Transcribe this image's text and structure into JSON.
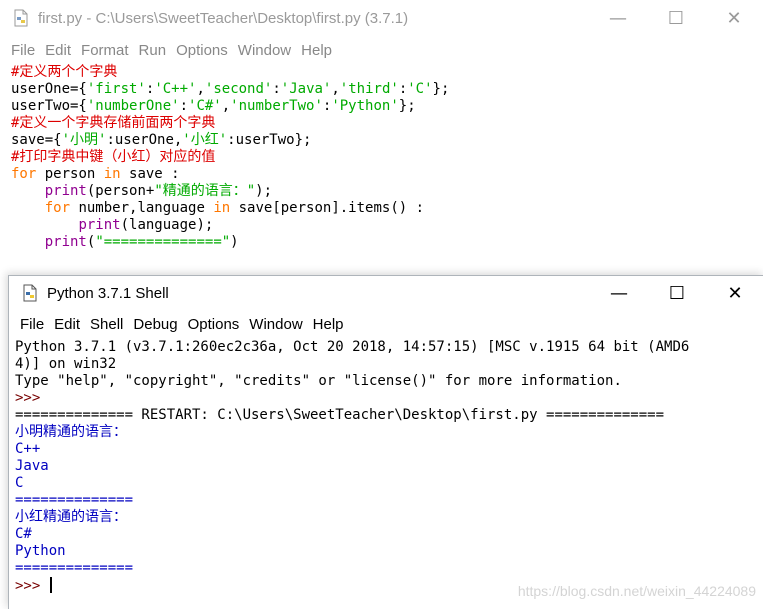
{
  "editor": {
    "title": "first.py - C:\\Users\\SweetTeacher\\Desktop\\first.py (3.7.1)",
    "menu": [
      "File",
      "Edit",
      "Format",
      "Run",
      "Options",
      "Window",
      "Help"
    ],
    "controls": {
      "minimize": "—",
      "maximize": "☐",
      "close": "✕"
    },
    "code": [
      [
        {
          "t": "#定义两个个字典",
          "c": "cmt"
        }
      ],
      [
        {
          "t": "userOne={",
          "c": ""
        },
        {
          "t": "'first'",
          "c": "str"
        },
        {
          "t": ":",
          "c": ""
        },
        {
          "t": "'C++'",
          "c": "str"
        },
        {
          "t": ",",
          "c": ""
        },
        {
          "t": "'second'",
          "c": "str"
        },
        {
          "t": ":",
          "c": ""
        },
        {
          "t": "'Java'",
          "c": "str"
        },
        {
          "t": ",",
          "c": ""
        },
        {
          "t": "'third'",
          "c": "str"
        },
        {
          "t": ":",
          "c": ""
        },
        {
          "t": "'C'",
          "c": "str"
        },
        {
          "t": "};",
          "c": ""
        }
      ],
      [
        {
          "t": "userTwo={",
          "c": ""
        },
        {
          "t": "'numberOne'",
          "c": "str"
        },
        {
          "t": ":",
          "c": ""
        },
        {
          "t": "'C#'",
          "c": "str"
        },
        {
          "t": ",",
          "c": ""
        },
        {
          "t": "'numberTwo'",
          "c": "str"
        },
        {
          "t": ":",
          "c": ""
        },
        {
          "t": "'Python'",
          "c": "str"
        },
        {
          "t": "};",
          "c": ""
        }
      ],
      [
        {
          "t": "#定义一个字典存储前面两个字典",
          "c": "cmt"
        }
      ],
      [
        {
          "t": "save={",
          "c": ""
        },
        {
          "t": "'小明'",
          "c": "str"
        },
        {
          "t": ":userOne,",
          "c": ""
        },
        {
          "t": "'小红'",
          "c": "str"
        },
        {
          "t": ":userTwo};",
          "c": ""
        }
      ],
      [
        {
          "t": "#打印字典中键（小红）对应的值",
          "c": "cmt"
        }
      ],
      [
        {
          "t": "for",
          "c": "kw"
        },
        {
          "t": " person ",
          "c": ""
        },
        {
          "t": "in",
          "c": "kw"
        },
        {
          "t": " save :",
          "c": ""
        }
      ],
      [
        {
          "t": "    ",
          "c": ""
        },
        {
          "t": "print",
          "c": "bi"
        },
        {
          "t": "(person+",
          "c": ""
        },
        {
          "t": "\"精通的语言：\"",
          "c": "str"
        },
        {
          "t": ");",
          "c": ""
        }
      ],
      [
        {
          "t": "    ",
          "c": ""
        },
        {
          "t": "for",
          "c": "kw"
        },
        {
          "t": " number,language ",
          "c": ""
        },
        {
          "t": "in",
          "c": "kw"
        },
        {
          "t": " save[person].items() :",
          "c": ""
        }
      ],
      [
        {
          "t": "        ",
          "c": ""
        },
        {
          "t": "print",
          "c": "bi"
        },
        {
          "t": "(language);",
          "c": ""
        }
      ],
      [
        {
          "t": "    ",
          "c": ""
        },
        {
          "t": "print",
          "c": "bi"
        },
        {
          "t": "(",
          "c": ""
        },
        {
          "t": "\"==============\"",
          "c": "str"
        },
        {
          "t": ")",
          "c": ""
        }
      ]
    ]
  },
  "shell": {
    "title": "Python 3.7.1 Shell",
    "menu": [
      "File",
      "Edit",
      "Shell",
      "Debug",
      "Options",
      "Window",
      "Help"
    ],
    "controls": {
      "minimize": "—",
      "maximize": "☐",
      "close": "✕"
    },
    "lines": [
      [
        {
          "t": "Python 3.7.1 (v3.7.1:260ec2c36a, Oct 20 2018, 14:57:15) [MSC v.1915 64 bit (AMD6",
          "c": "sys"
        }
      ],
      [
        {
          "t": "4)] on win32",
          "c": "sys"
        }
      ],
      [
        {
          "t": "Type \"help\", \"copyright\", \"credits\" or \"license()\" for more information.",
          "c": "sys"
        }
      ],
      [
        {
          "t": ">>>",
          "c": "prompt"
        }
      ],
      [
        {
          "t": "============== RESTART: C:\\Users\\SweetTeacher\\Desktop\\first.py ==============",
          "c": "sys"
        }
      ],
      [
        {
          "t": "小明精通的语言：",
          "c": "out"
        }
      ],
      [
        {
          "t": "C++",
          "c": "out"
        }
      ],
      [
        {
          "t": "Java",
          "c": "out"
        }
      ],
      [
        {
          "t": "C",
          "c": "out"
        }
      ],
      [
        {
          "t": "==============",
          "c": "out"
        }
      ],
      [
        {
          "t": "小红精通的语言：",
          "c": "out"
        }
      ],
      [
        {
          "t": "C#",
          "c": "out"
        }
      ],
      [
        {
          "t": "Python",
          "c": "out"
        }
      ],
      [
        {
          "t": "==============",
          "c": "out"
        }
      ]
    ],
    "prompt": ">>> ",
    "watermark": "https://blog.csdn.net/weixin_44224089"
  },
  "colors": {
    "keyword": "#ff7700",
    "builtin": "#900090",
    "string": "#00aa00",
    "comment": "#dd0000",
    "output": "#0000c0",
    "prompt": "#770000"
  }
}
